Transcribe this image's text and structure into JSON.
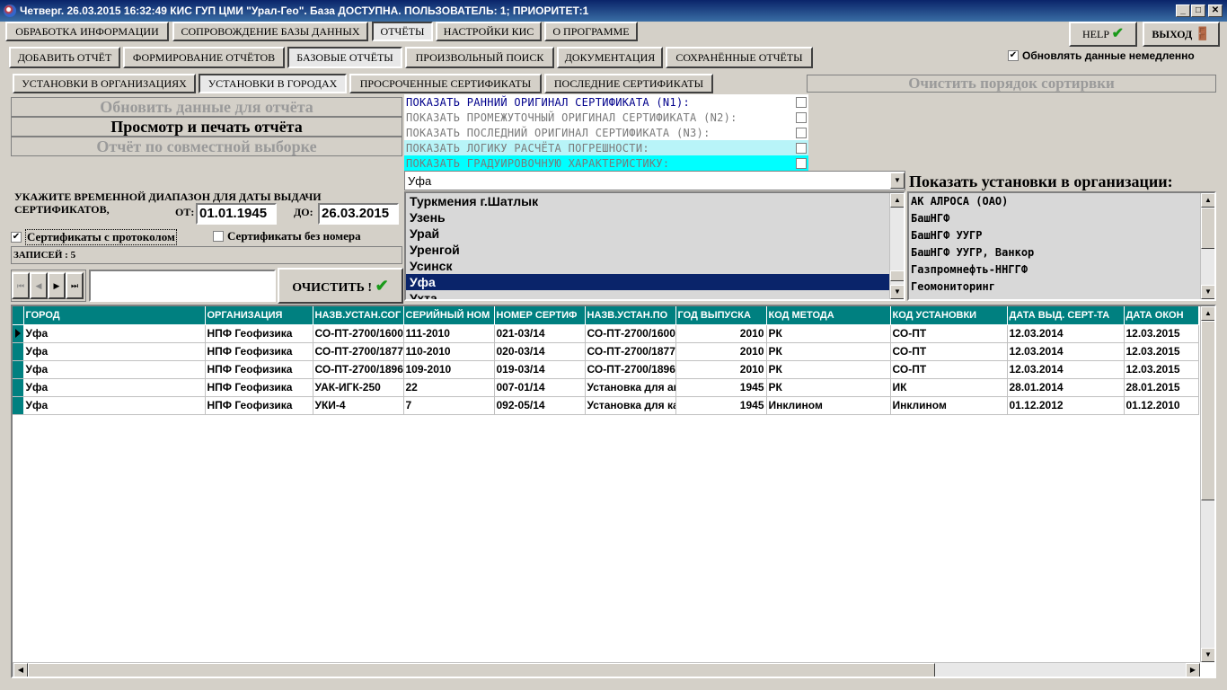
{
  "window": {
    "title": "Четверг. 26.03.2015 16:32:49 КИС ГУП ЦМИ \"Урал-Гео\". База ДОСТУПНА. ПОЛЬЗОВАТЕЛЬ: 1; ПРИОРИТЕТ:1",
    "min": "_",
    "max": "□",
    "close": "✕"
  },
  "menu": [
    {
      "label": "ОБРАБОТКА ИНФОРМАЦИИ"
    },
    {
      "label": "СОПРОВОЖДЕНИЕ БАЗЫ ДАННЫХ"
    },
    {
      "label": "ОТЧЁТЫ"
    },
    {
      "label": "НАСТРОЙКИ КИС"
    },
    {
      "label": "О ПРОГРАММЕ"
    }
  ],
  "help": {
    "label": "HELP",
    "icon": "✔"
  },
  "exit": {
    "label": "ВЫХОД",
    "icon": "🚪"
  },
  "subtabs": [
    {
      "label": "ДОБАВИТЬ ОТЧЁТ"
    },
    {
      "label": "ФОРМИРОВАНИЕ ОТЧЁТОВ"
    },
    {
      "label": "БАЗОВЫЕ ОТЧЁТЫ"
    },
    {
      "label": "ПРОИЗВОЛЬНЫЙ ПОИСК"
    },
    {
      "label": "ДОКУМЕНТАЦИЯ"
    },
    {
      "label": "СОХРАНЁННЫЕ ОТЧЁТЫ"
    }
  ],
  "auto_update": {
    "label": "Обновлять данные немедленно",
    "mark": "✔"
  },
  "reporttabs": [
    {
      "label": "УСТАНОВКИ В ОРГАНИЗАЦИЯХ"
    },
    {
      "label": "УСТАНОВКИ В ГОРОДАХ"
    },
    {
      "label": "ПРОСРОЧЕННЫЕ СЕРТИФИКАТЫ"
    },
    {
      "label": "ПОСЛЕДНИЕ СЕРТИФИКАТЫ"
    }
  ],
  "clear_sort": "Очистить порядок сортирвки",
  "actions": {
    "refresh": "Обновить данные для отчёта",
    "print": "Просмотр и печать отчёта",
    "joint": "Отчёт по совместной выборке"
  },
  "options": [
    {
      "label": "ПОКАЗАТЬ РАННИЙ ОРИГИНАЛ СЕРТИФИКАТА (N1):",
      "color": "#00008b",
      "bg": "#ffffff"
    },
    {
      "label": "ПОКАЗАТЬ ПРОМЕЖУТОЧНЫЙ ОРИГИНАЛ СЕРТИФИКАТА (N2):",
      "color": "#7a7a7a",
      "bg": "#ffffff"
    },
    {
      "label": "ПОКАЗАТЬ ПОСЛЕДНИЙ ОРИГИНАЛ СЕРТИФИКАТА (N3):",
      "color": "#7a7a7a",
      "bg": "#ffffff"
    },
    {
      "label": "ПОКАЗАТЬ ЛОГИКУ РАСЧЁТА ПОГРЕШНОСТИ:",
      "color": "#7a7a7a",
      "bg": "#b8f4f8"
    },
    {
      "label": "ПОКАЗАТЬ ГРАДУИРОВОЧНУЮ ХАРАКТЕРИСТИКУ:",
      "color": "#7a7a7a",
      "bg": "#00ffff"
    }
  ],
  "date_range": {
    "prompt": "УКАЖИТЕ ВРЕМЕННОЙ ДИАПАЗОН ДЛЯ ДАТЫ ВЫДАЧИ СЕРТИФИКАТОВ,",
    "from_label": "ОТ:",
    "from_value": "01.01.1945",
    "to_label": "ДО:",
    "to_value": "26.03.2015"
  },
  "filters": {
    "with_protocol": {
      "label": "Сертификаты с протоколом",
      "mark": "✔"
    },
    "no_number": {
      "label": "Сертификаты без номера",
      "mark": ""
    }
  },
  "records": "ЗАПИСЕЙ : 5",
  "nav": {
    "first": "⏮",
    "prev": "◀",
    "next": "▶",
    "last": "⏭",
    "field_value": "",
    "field_placeholder": ""
  },
  "clear_btn": {
    "label": "ОЧИСТИТЬ !",
    "icon": "✔"
  },
  "city_combo": {
    "value": "Уфа",
    "arrow": "▼"
  },
  "city_list": [
    {
      "label": "Туркмения г.Шатлык"
    },
    {
      "label": "Узень"
    },
    {
      "label": "Урай"
    },
    {
      "label": "Уренгой"
    },
    {
      "label": "Усинск"
    },
    {
      "label": "Уфа",
      "selected": true
    },
    {
      "label": "Ухта"
    }
  ],
  "org_header": "Показать установки в организации:",
  "org_list": [
    {
      "label": "АК АЛРОСА (ОАО)"
    },
    {
      "label": "БашНГФ"
    },
    {
      "label": "БашНГФ УУГР"
    },
    {
      "label": "БашНГФ УУГР, Ванкор"
    },
    {
      "label": "Газпромнефть-ННГГФ"
    },
    {
      "label": "Геомониторинг"
    }
  ],
  "scroll": {
    "up": "▲",
    "down": "▼",
    "left": "◀",
    "right": "▶"
  },
  "table": {
    "columns": [
      "ГОРОД",
      "ОРГАНИЗАЦИЯ",
      "НАЗВ.УСТАН.СОГ",
      "СЕРИЙНЫЙ НОМ",
      "НОМЕР СЕРТИФ",
      "НАЗВ.УСТАН.ПО",
      "ГОД ВЫПУСКА",
      "КОД МЕТОДА",
      "КОД УСТАНОВКИ",
      "ДАТА ВЫД. СЕРТ-ТА",
      "ДАТА ОКОН"
    ],
    "rows": [
      [
        "Уфа",
        "НПФ Геофизика",
        "СО-ПТ-2700/1600",
        "111-2010",
        "021-03/14",
        "СО-ПТ-2700/1600",
        "2010",
        "РК",
        "СО-ПТ",
        "12.03.2014",
        "12.03.2015"
      ],
      [
        "Уфа",
        "НПФ Геофизика",
        "СО-ПТ-2700/1877",
        "110-2010",
        "020-03/14",
        "СО-ПТ-2700/1877",
        "2010",
        "РК",
        "СО-ПТ",
        "12.03.2014",
        "12.03.2015"
      ],
      [
        "Уфа",
        "НПФ Геофизика",
        "СО-ПТ-2700/1896",
        "109-2010",
        "019-03/14",
        "СО-ПТ-2700/1896",
        "2010",
        "РК",
        "СО-ПТ",
        "12.03.2014",
        "12.03.2015"
      ],
      [
        "Уфа",
        "НПФ Геофизика",
        "УАК-ИГК-250",
        "22",
        "007-01/14",
        "Установка для ак",
        "1945",
        "РК",
        "ИК",
        "28.01.2014",
        "28.01.2015"
      ],
      [
        "Уфа",
        "НПФ Геофизика",
        "УКИ-4",
        "7",
        "092-05/14",
        "Установка для ка",
        "1945",
        "Инклином",
        "Инклином",
        "01.12.2012",
        "01.12.2010"
      ]
    ]
  }
}
